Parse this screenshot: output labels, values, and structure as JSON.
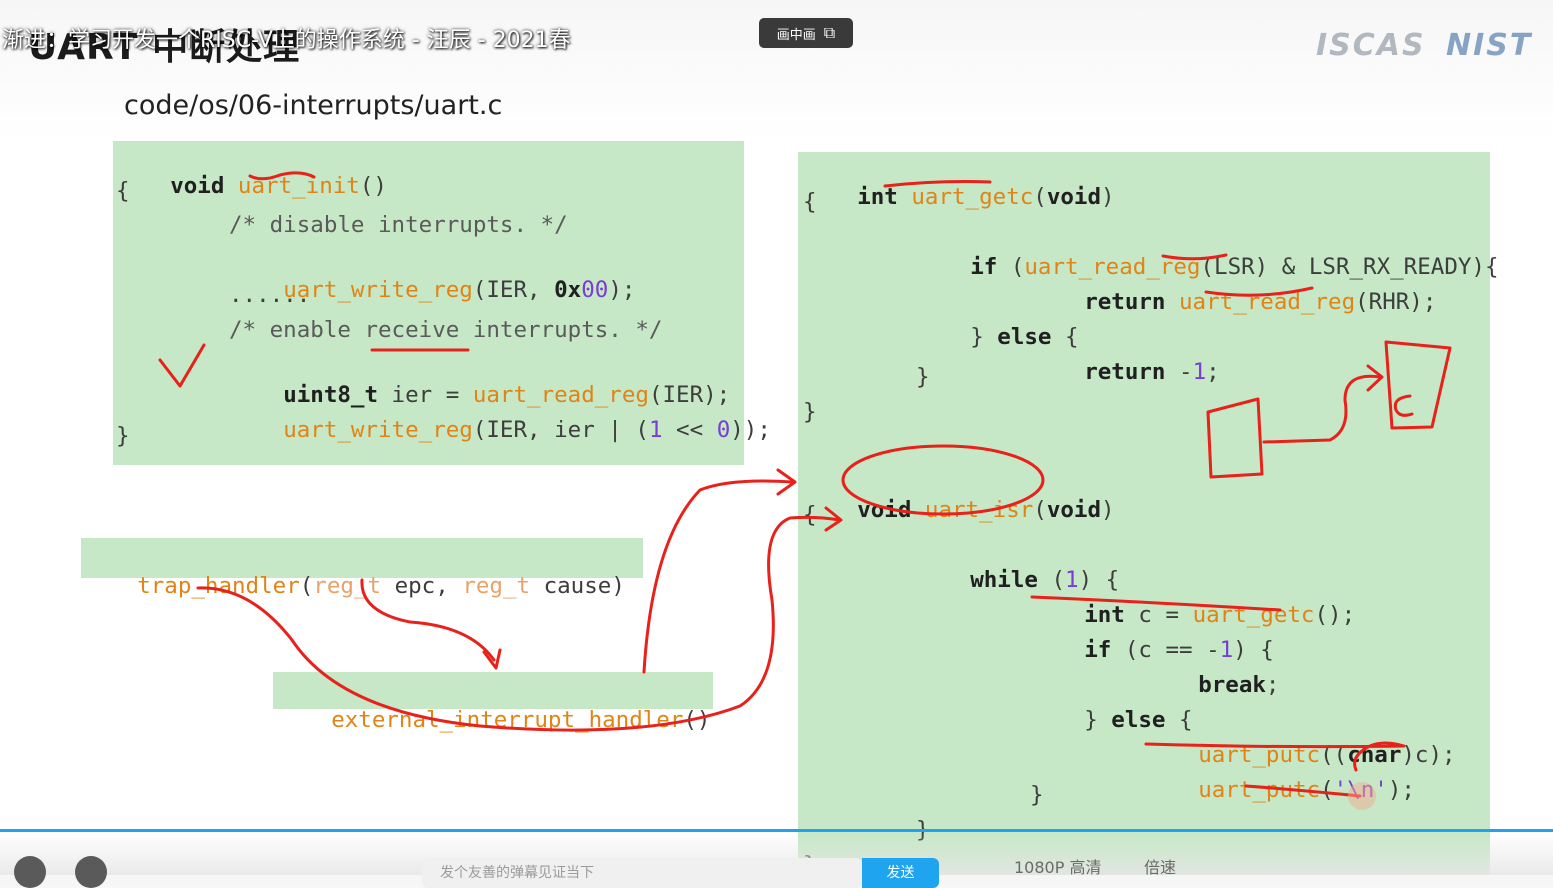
{
  "video": {
    "title": "渐进：学习开发一个RISC-V上的操作系统 - 汪辰 - 2021春",
    "pip_label": "画中画",
    "pip_icon": "picture-in-picture-icon"
  },
  "slide": {
    "heading": "UART 中断处理",
    "logos": {
      "iscas": "ISCAS",
      "nist": "NIST"
    },
    "file_path": "code/os/06-interrupts/uart.c",
    "uart_init": {
      "l1_kw": "void",
      "l1_fn": "uart_init",
      "l1_rest": "()",
      "l2": "{",
      "l3": "/* disable interrupts. */",
      "l4_fn": "uart_write_reg",
      "l4_a": "(IER, ",
      "l4_num_kw": "0x",
      "l4_num": "00",
      "l4_b": ");",
      "l5": "......",
      "l6": "/* enable receive interrupts. */",
      "l7_kw": "uint8_t",
      "l7_a": " ier = ",
      "l7_fn": "uart_read_reg",
      "l7_b": "(IER);",
      "l8_fn": "uart_write_reg",
      "l8_a": "(IER, ier | (",
      "l8_n1": "1",
      "l8_b": " << ",
      "l8_n2": "0",
      "l8_c": "));",
      "l9": "}"
    },
    "trap_handler": {
      "fn": "trap_handler",
      "p1": "(",
      "t1": "reg_t",
      "a1": " epc, ",
      "t2": "reg_t",
      "a2": " cause)"
    },
    "external_handler": {
      "fn": "external_interrupt_handler",
      "rest": "()"
    },
    "uart_getc": {
      "l1_kw": "int",
      "l1_fn": "uart_getc",
      "l1_a": "(",
      "l1_kw2": "void",
      "l1_b": ")",
      "l2": "{",
      "l3_kw": "if",
      "l3_a": " (",
      "l3_fn": "uart_read_reg",
      "l3_b": "(LSR) & LSR_RX_READY){",
      "l4_kw": "return",
      "l4_sp": " ",
      "l4_fn": "uart_read_reg",
      "l4_b": "(RHR);",
      "l5_a": "} ",
      "l5_kw": "else",
      "l5_b": " {",
      "l6_kw": "return",
      "l6_a": " -",
      "l6_num": "1",
      "l6_b": ";",
      "l7": "}",
      "l8": "}"
    },
    "uart_isr": {
      "l1_kw": "void",
      "l1_sp": " ",
      "l1_fn": "uart_isr",
      "l1_a": "(",
      "l1_kw2": "void",
      "l1_b": ")",
      "l2": "{",
      "l3_kw": "while",
      "l3_a": " (",
      "l3_num": "1",
      "l3_b": ") {",
      "l4_kw": "int",
      "l4_a": " c = ",
      "l4_fn": "uart_getc",
      "l4_b": "();",
      "l5_kw": "if",
      "l5_a": " (c == -",
      "l5_num": "1",
      "l5_b": ") {",
      "l6_kw": "break",
      "l6_b": ";",
      "l7_a": "} ",
      "l7_kw": "else",
      "l7_b": " {",
      "l8_fn": "uart_putc",
      "l8_a": "((",
      "l8_kw": "char",
      "l8_b": ")c);",
      "l9_fn": "uart_putc",
      "l9_a": "(",
      "l9_str": "'\\n'",
      "l9_b": ");",
      "l10": "}",
      "l11": "}",
      "l12": "}"
    }
  },
  "annotation_colors": {
    "pen": "#e8211b"
  },
  "player": {
    "progress_color": "#1fa4ef",
    "danmaku_placeholder": "发个友善的弹幕见证当下",
    "send_label": "发送",
    "quality_label": "1080P 高清",
    "speed_label": "倍速"
  }
}
